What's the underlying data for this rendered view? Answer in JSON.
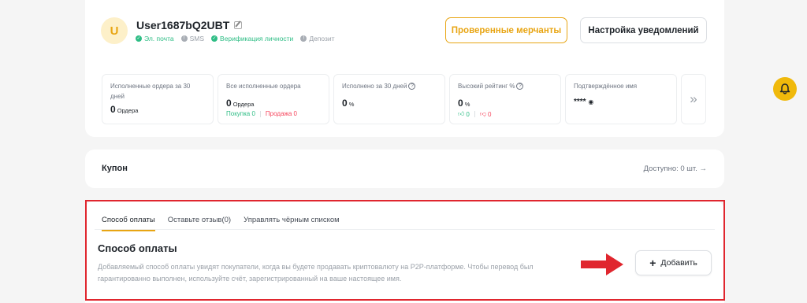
{
  "profile": {
    "avatar_letter": "U",
    "username": "User1687bQ2UBT",
    "badges": [
      {
        "label": "Эл. почта",
        "state": "verified"
      },
      {
        "label": "SMS",
        "state": "unverified"
      },
      {
        "label": "Верификация личности",
        "state": "verified"
      },
      {
        "label": "Депозит",
        "state": "unverified"
      }
    ],
    "merchants_button": "Проверенные мерчанты",
    "notify_button": "Настройка уведомлений"
  },
  "stats": {
    "completed_30d": {
      "label": "Исполненные ордера за 30 дней",
      "value": "0",
      "unit": "Ордера"
    },
    "completed_all": {
      "label": "Все исполненные ордера",
      "value": "0",
      "unit": "Ордера",
      "buy": "Покупка 0",
      "sell": "Продажа 0"
    },
    "rate_30d": {
      "label": "Исполнено за 30 дней",
      "value": "0",
      "unit": "%"
    },
    "positive_rate": {
      "label": "Высокий рейтинг %",
      "value": "0",
      "unit": "%",
      "likes": "0",
      "dislikes": "0"
    },
    "verified_name": {
      "label": "Подтверждённое имя",
      "value": "****"
    }
  },
  "coupon": {
    "title": "Купон",
    "available": "Доступно: 0 шт."
  },
  "payment": {
    "tabs": [
      {
        "label": "Способ оплаты",
        "active": true
      },
      {
        "label": "Оставьте отзыв(0)",
        "active": false
      },
      {
        "label": "Управлять чёрным списком",
        "active": false
      }
    ],
    "title": "Способ оплаты",
    "description": "Добавляемый способ оплаты увидят покупатели, когда вы будете продавать криптовалюту на P2P-платформе. Чтобы перевод был гарантированно выполнен, используйте счёт, зарегистрированный на ваше настоящее имя.",
    "add_button": "Добавить"
  },
  "colors": {
    "accent": "#e8a513",
    "green": "#2ebd85",
    "red": "#f6465d",
    "highlight_frame": "#e0262e",
    "bell": "#f0b90b"
  }
}
